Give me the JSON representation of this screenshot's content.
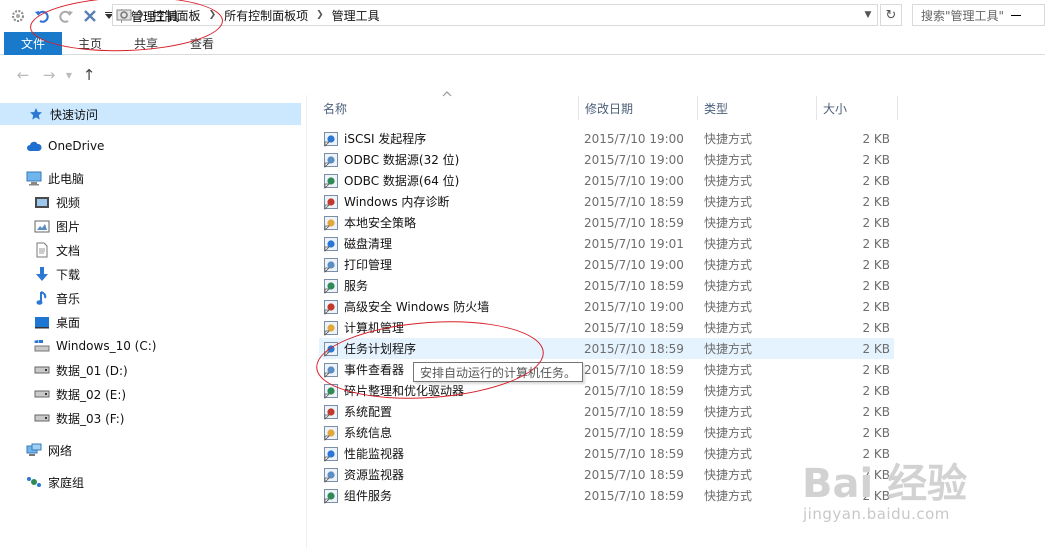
{
  "window": {
    "title": "管理工具",
    "colors": {
      "accent": "#1979ca",
      "selection": "#cce8ff",
      "hover": "#e5f3ff",
      "annotation": "#d8202a"
    }
  },
  "ribbon": {
    "tabs": [
      {
        "label": "文件",
        "active": true
      },
      {
        "label": "主页"
      },
      {
        "label": "共享"
      },
      {
        "label": "查看"
      }
    ]
  },
  "address": {
    "crumbs": [
      "控制面板",
      "所有控制面板项",
      "管理工具"
    ],
    "search_placeholder": "搜索\"管理工具\""
  },
  "nav": {
    "items": [
      {
        "label": "快速访问",
        "icon": "star-icon",
        "selected": true
      },
      {
        "label": "OneDrive",
        "icon": "cloud-icon"
      },
      {
        "label": "此电脑",
        "icon": "computer-icon"
      },
      {
        "label": "视频",
        "icon": "video-folder-icon"
      },
      {
        "label": "图片",
        "icon": "pictures-folder-icon"
      },
      {
        "label": "文档",
        "icon": "documents-folder-icon"
      },
      {
        "label": "下载",
        "icon": "download-arrow-icon"
      },
      {
        "label": "音乐",
        "icon": "music-note-icon"
      },
      {
        "label": "桌面",
        "icon": "desktop-icon"
      },
      {
        "label": "Windows_10 (C:)",
        "icon": "system-drive-icon"
      },
      {
        "label": "数据_01 (D:)",
        "icon": "drive-icon"
      },
      {
        "label": "数据_02 (E:)",
        "icon": "drive-icon"
      },
      {
        "label": "数据_03 (F:)",
        "icon": "drive-icon"
      },
      {
        "label": "网络",
        "icon": "network-icon"
      },
      {
        "label": "家庭组",
        "icon": "homegroup-icon"
      }
    ]
  },
  "columns": {
    "name": "名称",
    "date": "修改日期",
    "type": "类型",
    "size": "大小"
  },
  "files": [
    {
      "name": "iSCSI 发起程序",
      "date": "2015/7/10 19:00",
      "type": "快捷方式",
      "size": "2 KB",
      "icon": "iscsi-icon"
    },
    {
      "name": "ODBC 数据源(32 位)",
      "date": "2015/7/10 19:00",
      "type": "快捷方式",
      "size": "2 KB",
      "icon": "odbc-icon"
    },
    {
      "name": "ODBC 数据源(64 位)",
      "date": "2015/7/10 19:00",
      "type": "快捷方式",
      "size": "2 KB",
      "icon": "odbc-icon"
    },
    {
      "name": "Windows 内存诊断",
      "date": "2015/7/10 18:59",
      "type": "快捷方式",
      "size": "2 KB",
      "icon": "memory-diagnostic-icon"
    },
    {
      "name": "本地安全策略",
      "date": "2015/7/10 18:59",
      "type": "快捷方式",
      "size": "2 KB",
      "icon": "security-policy-icon"
    },
    {
      "name": "磁盘清理",
      "date": "2015/7/10 19:01",
      "type": "快捷方式",
      "size": "2 KB",
      "icon": "disk-cleanup-icon"
    },
    {
      "name": "打印管理",
      "date": "2015/7/10 19:00",
      "type": "快捷方式",
      "size": "2 KB",
      "icon": "printer-icon"
    },
    {
      "name": "服务",
      "date": "2015/7/10 18:59",
      "type": "快捷方式",
      "size": "2 KB",
      "icon": "services-gear-icon"
    },
    {
      "name": "高级安全 Windows 防火墙",
      "date": "2015/7/10 19:00",
      "type": "快捷方式",
      "size": "2 KB",
      "icon": "firewall-icon"
    },
    {
      "name": "计算机管理",
      "date": "2015/7/10 18:59",
      "type": "快捷方式",
      "size": "2 KB",
      "icon": "computer-management-icon"
    },
    {
      "name": "任务计划程序",
      "date": "2015/7/10 18:59",
      "type": "快捷方式",
      "size": "2 KB",
      "icon": "task-scheduler-clock-icon",
      "hover": true
    },
    {
      "name": "事件查看器",
      "date": "2015/7/10 18:59",
      "type": "快捷方式",
      "size": "2 KB",
      "icon": "event-viewer-icon"
    },
    {
      "name": "碎片整理和优化驱动器",
      "date": "2015/7/10 18:59",
      "type": "快捷方式",
      "size": "2 KB",
      "icon": "defrag-icon"
    },
    {
      "name": "系统配置",
      "date": "2015/7/10 18:59",
      "type": "快捷方式",
      "size": "2 KB",
      "icon": "system-config-icon"
    },
    {
      "name": "系统信息",
      "date": "2015/7/10 18:59",
      "type": "快捷方式",
      "size": "2 KB",
      "icon": "system-info-icon"
    },
    {
      "name": "性能监视器",
      "date": "2015/7/10 18:59",
      "type": "快捷方式",
      "size": "2 KB",
      "icon": "performance-monitor-icon"
    },
    {
      "name": "资源监视器",
      "date": "2015/7/10 18:59",
      "type": "快捷方式",
      "size": "2 KB",
      "icon": "resource-monitor-icon"
    },
    {
      "name": "组件服务",
      "date": "2015/7/10 18:59",
      "type": "快捷方式",
      "size": "2 KB",
      "icon": "component-services-icon"
    }
  ],
  "tooltip": "安排自动运行的计算机任务。",
  "watermark": {
    "brand": "Bai 经验",
    "url": "jingyan.baidu.com"
  }
}
